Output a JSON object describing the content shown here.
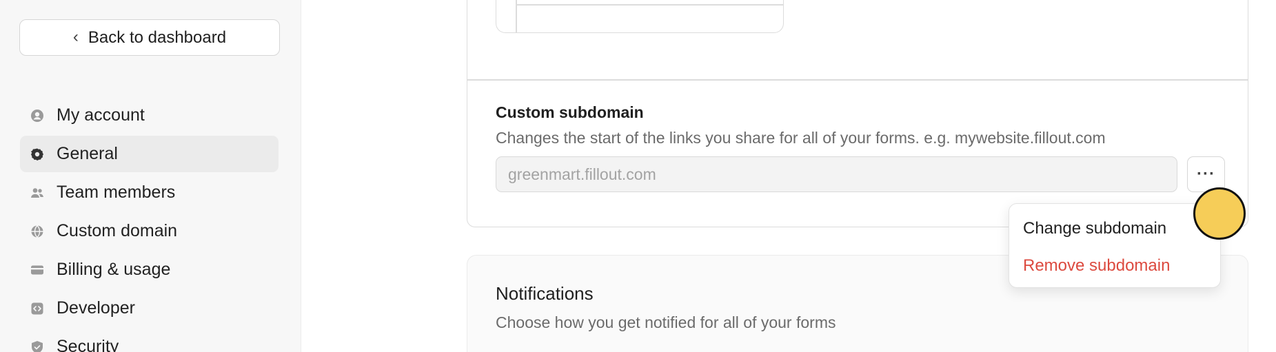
{
  "sidebar": {
    "back_label": "Back to dashboard",
    "items": [
      {
        "label": "My account",
        "icon": "user-circle-icon",
        "active": false
      },
      {
        "label": "General",
        "icon": "gear-icon",
        "active": true
      },
      {
        "label": "Team members",
        "icon": "users-icon",
        "active": false
      },
      {
        "label": "Custom domain",
        "icon": "globe-icon",
        "active": false
      },
      {
        "label": "Billing & usage",
        "icon": "credit-card-icon",
        "active": false
      },
      {
        "label": "Developer",
        "icon": "code-icon",
        "active": false
      },
      {
        "label": "Security",
        "icon": "shield-icon",
        "active": false
      }
    ]
  },
  "custom_subdomain": {
    "title": "Custom subdomain",
    "description": "Changes the start of the links you share for all of your forms. e.g. mywebsite.fillout.com",
    "placeholder": "greenmart.fillout.com",
    "more_label": "···"
  },
  "dropdown": {
    "change_label": "Change subdomain",
    "remove_label": "Remove subdomain"
  },
  "notifications": {
    "title": "Notifications",
    "description": "Choose how you get notified for all of your forms"
  },
  "colors": {
    "danger": "#dc4a3f",
    "cursor": "#f6cd58",
    "active_bg": "#ebebeb"
  }
}
